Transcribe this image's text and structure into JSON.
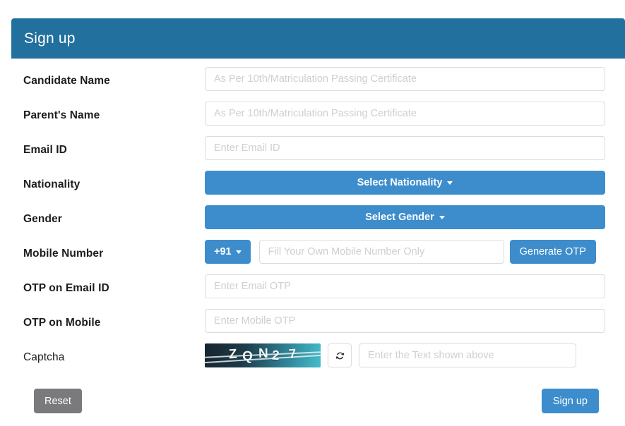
{
  "header": {
    "title": "Sign up",
    "bg_color": "#21709e"
  },
  "colors": {
    "primary_blue": "#3d8dcc",
    "header_blue": "#21709e",
    "reset_gray": "#7a7a7d",
    "placeholder_gray": "#cfcfcf",
    "captcha_gradient_start": "#16242d",
    "captcha_gradient_end": "#45bdcb"
  },
  "fields": {
    "candidate_name": {
      "label": "Candidate Name",
      "placeholder": "As Per 10th/Matriculation Passing Certificate",
      "value": ""
    },
    "parents_name": {
      "label": "Parent's Name",
      "placeholder": "As Per 10th/Matriculation Passing Certificate",
      "value": ""
    },
    "email_id": {
      "label": "Email ID",
      "placeholder": "Enter Email ID",
      "value": ""
    },
    "nationality": {
      "label": "Nationality",
      "selected": "Select Nationality"
    },
    "gender": {
      "label": "Gender",
      "selected": "Select Gender"
    },
    "mobile_number": {
      "label": "Mobile Number",
      "country_code": "+91",
      "placeholder": "Fill Your Own Mobile Number Only",
      "value": "",
      "generate_otp_label": "Generate OTP"
    },
    "otp_email": {
      "label": "OTP on Email ID",
      "placeholder": "Enter Email OTP",
      "value": ""
    },
    "otp_mobile": {
      "label": "OTP on Mobile",
      "placeholder": "Enter Mobile OTP",
      "value": ""
    },
    "captcha": {
      "label": "Captcha",
      "image_text": "ZQN27",
      "characters": [
        "Z",
        "Q",
        "N",
        "2",
        "7"
      ],
      "refresh_icon": "refresh-icon",
      "placeholder": "Enter the Text shown above",
      "value": ""
    }
  },
  "footer": {
    "reset_label": "Reset",
    "signup_label": "Sign up"
  }
}
